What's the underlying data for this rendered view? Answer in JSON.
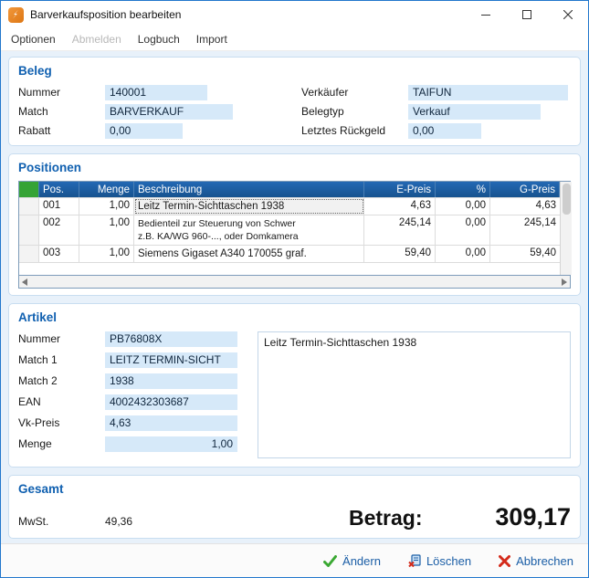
{
  "window": {
    "title": "Barverkaufsposition bearbeiten"
  },
  "menu": {
    "items": [
      "Optionen",
      "Abmelden",
      "Logbuch",
      "Import"
    ]
  },
  "beleg": {
    "title": "Beleg",
    "nummer": {
      "label": "Nummer",
      "value": "140001"
    },
    "match": {
      "label": "Match",
      "value": "BARVERKAUF"
    },
    "rabatt": {
      "label": "Rabatt",
      "value": "0,00"
    },
    "verkaeufer": {
      "label": "Verkäufer",
      "value": "TAIFUN"
    },
    "belegtyp": {
      "label": "Belegtyp",
      "value": "Verkauf"
    },
    "rueckgeld": {
      "label": "Letztes Rückgeld",
      "value": "0,00"
    }
  },
  "positionen": {
    "title": "Positionen",
    "columns": [
      "Pos.",
      "Menge",
      "Beschreibung",
      "E-Preis",
      "%",
      "G-Preis"
    ],
    "rows": [
      {
        "pos": "001",
        "menge": "1,00",
        "desc1": "Leitz Termin-Sichttaschen 1938",
        "epreis": "4,63",
        "pct": "0,00",
        "gpreis": "4,63"
      },
      {
        "pos": "002",
        "menge": "1,00",
        "desc1": "Bedienteil zur Steuerung von Schwer",
        "desc2": "z.B. KA/WG 960-..., oder Domkamera",
        "epreis": "245,14",
        "pct": "0,00",
        "gpreis": "245,14"
      },
      {
        "pos": "003",
        "menge": "1,00",
        "desc1": "Siemens Gigaset A340 170055 graf.",
        "epreis": "59,40",
        "pct": "0,00",
        "gpreis": "59,40"
      }
    ]
  },
  "artikel": {
    "title": "Artikel",
    "nummer": {
      "label": "Nummer",
      "value": "PB76808X"
    },
    "match1": {
      "label": "Match 1",
      "value": "LEITZ TERMIN-SICHT"
    },
    "match2": {
      "label": "Match 2",
      "value": "1938"
    },
    "ean": {
      "label": "EAN",
      "value": "4002432303687"
    },
    "vkpreis": {
      "label": "Vk-Preis",
      "value": "4,63"
    },
    "menge": {
      "label": "Menge",
      "value": "1,00"
    },
    "beschreibung": "Leitz Termin-Sichttaschen 1938"
  },
  "gesamt": {
    "title": "Gesamt",
    "mwst_label": "MwSt.",
    "mwst_value": "49,36",
    "betrag_label": "Betrag:",
    "betrag_value": "309,17"
  },
  "actions": {
    "aendern": "Ändern",
    "loeschen": "Löschen",
    "abbrechen": "Abbrechen"
  },
  "colors": {
    "accent_blue": "#1060b0",
    "input_bg": "#d6e9f9",
    "grid_header_bg": "#1d5fa8",
    "selector_green": "#35a335",
    "check_green": "#3aa832",
    "cancel_red": "#d42a1a"
  }
}
